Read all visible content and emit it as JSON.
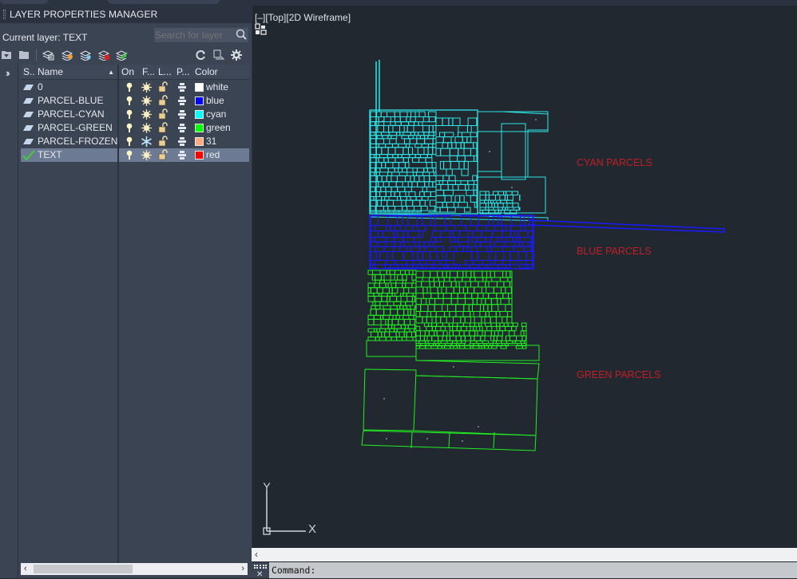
{
  "palette": {
    "title": "LAYER PROPERTIES MANAGER",
    "current_layer": "Current layer: TEXT",
    "search_placeholder": "Search for layer",
    "toolbar_icons": [
      "new-property-filter-icon",
      "new-group-filter-icon",
      "layer-states-manager-icon",
      "new-layer-icon",
      "new-layer-vp-frozen-icon",
      "delete-layer-icon",
      "set-current-icon",
      "refresh-icon",
      "settings-display-icon",
      "gear-icon"
    ],
    "columns": {
      "status": "S..",
      "name": "Name",
      "on": "On",
      "freeze": "F...",
      "lock": "L...",
      "plot": "P...",
      "color": "Color"
    },
    "sort_column": "Name",
    "layers": [
      {
        "status": "layer",
        "name": "0",
        "on": true,
        "frozen": false,
        "locked": false,
        "color_name": "white",
        "color_hex": "#ffffff",
        "selected": false
      },
      {
        "status": "layer",
        "name": "PARCEL-BLUE",
        "on": true,
        "frozen": false,
        "locked": false,
        "color_name": "blue",
        "color_hex": "#0000ff",
        "selected": false
      },
      {
        "status": "layer",
        "name": "PARCEL-CYAN",
        "on": true,
        "frozen": false,
        "locked": false,
        "color_name": "cyan",
        "color_hex": "#00ffff",
        "selected": false
      },
      {
        "status": "layer",
        "name": "PARCEL-GREEN",
        "on": true,
        "frozen": false,
        "locked": false,
        "color_name": "green",
        "color_hex": "#00ff00",
        "selected": false
      },
      {
        "status": "layer",
        "name": "PARCEL-FROZEN",
        "on": true,
        "frozen": true,
        "locked": false,
        "color_name": "31",
        "color_hex": "#ffaa7f",
        "selected": false
      },
      {
        "status": "current",
        "name": "TEXT",
        "on": true,
        "frozen": false,
        "locked": false,
        "color_name": "red",
        "color_hex": "#ff0000",
        "selected": true
      }
    ]
  },
  "viewport": {
    "label": "[–][Top][2D Wireframe]",
    "annotations": [
      {
        "text": "CYAN PARCELS"
      },
      {
        "text": "BLUE PARCELS"
      },
      {
        "text": "GREEN PARCELS"
      }
    ],
    "ucs": {
      "x_label": "X",
      "y_label": "Y"
    },
    "colors": {
      "cyan": "#2ee6e6",
      "blue": "#1a1aff",
      "green": "#22ee22",
      "text": "#c11e25",
      "background": "#212830"
    }
  },
  "command": {
    "prompt": "Command:",
    "close_glyph": "✕"
  },
  "scroll": {
    "left": "‹",
    "right": "›"
  }
}
